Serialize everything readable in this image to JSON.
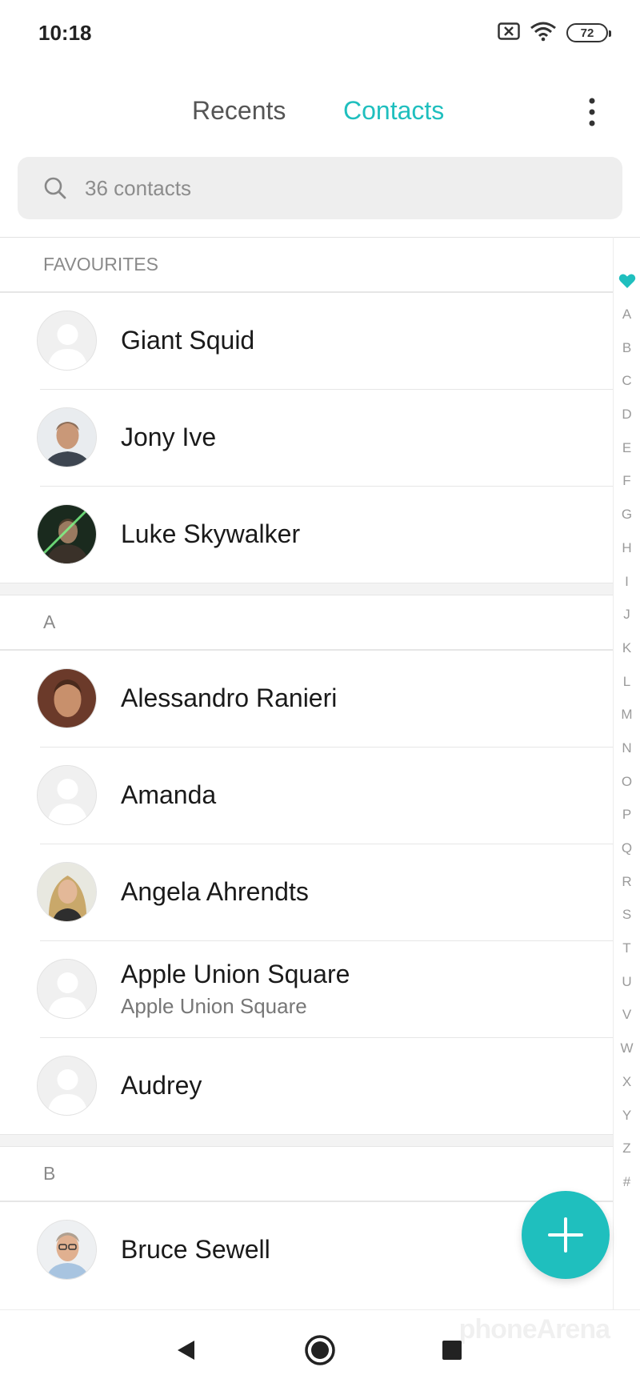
{
  "status_bar": {
    "time": "10:18",
    "battery": "72"
  },
  "tabs": {
    "recents": "Recents",
    "contacts": "Contacts"
  },
  "search": {
    "placeholder": "36 contacts"
  },
  "sections": {
    "favourites": "FAVOURITES",
    "a": "A",
    "b": "B"
  },
  "favourites": [
    {
      "name": "Giant Squid",
      "avatar": "placeholder"
    },
    {
      "name": "Jony Ive",
      "avatar": "photo"
    },
    {
      "name": "Luke Skywalker",
      "avatar": "photo"
    }
  ],
  "contacts_a": [
    {
      "name": "Alessandro Ranieri",
      "avatar": "photo"
    },
    {
      "name": "Amanda",
      "avatar": "placeholder"
    },
    {
      "name": "Angela Ahrendts",
      "avatar": "photo"
    },
    {
      "name": "Apple Union Square",
      "subtitle": "Apple Union Square",
      "avatar": "placeholder"
    },
    {
      "name": "Audrey",
      "avatar": "placeholder"
    }
  ],
  "contacts_b": [
    {
      "name": "Bruce Sewell",
      "avatar": "photo"
    }
  ],
  "alphabet": [
    "A",
    "B",
    "C",
    "D",
    "E",
    "F",
    "G",
    "H",
    "I",
    "J",
    "K",
    "L",
    "M",
    "N",
    "O",
    "P",
    "Q",
    "R",
    "S",
    "T",
    "U",
    "V",
    "W",
    "X",
    "Y",
    "Z",
    "#"
  ],
  "watermark": "phoneArena",
  "colors": {
    "accent": "#1fbfbe",
    "text_secondary": "#8a8a8a",
    "divider": "#e6e6e6"
  }
}
